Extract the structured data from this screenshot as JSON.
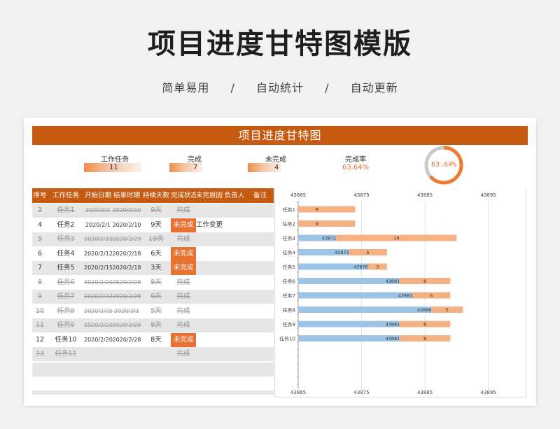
{
  "page": {
    "title": "项目进度甘特图模版",
    "subtitle": [
      "简单易用",
      "/",
      "自动统计",
      "/",
      "自动更新"
    ]
  },
  "sheet": {
    "banner": "项目进度甘特图",
    "stats": {
      "total_label": "工作任务",
      "total_value": "11",
      "done_label": "完成",
      "done_value": "7",
      "undone_label": "未完成",
      "undone_value": "4",
      "rate_label": "完成率",
      "rate_value": "63.64%",
      "donut_text": "63.64%",
      "rate_fraction": 0.6364
    },
    "columns": [
      "序号",
      "工作任务",
      "开始日期",
      "结束时期",
      "持续天数",
      "完成状态",
      "未完原因",
      "负责人",
      "备注"
    ],
    "rows": [
      {
        "id": "3",
        "task": "任务1",
        "start": "2020/2/1",
        "end": "2020/2/10",
        "days": "9天",
        "status": "完成",
        "reason": "",
        "done": true
      },
      {
        "id": "4",
        "task": "任务2",
        "start": "2020/2/1",
        "end": "2020/2/10",
        "days": "9天",
        "status": "未完成",
        "reason": "工作变更",
        "done": false
      },
      {
        "id": "5",
        "task": "任务3",
        "start": "2020/2/10",
        "end": "2020/2/29",
        "days": "19天",
        "status": "完成",
        "reason": "",
        "done": true
      },
      {
        "id": "6",
        "task": "任务4",
        "start": "2020/2/12",
        "end": "2020/2/18",
        "days": "6天",
        "status": "未完成",
        "reason": "",
        "done": false
      },
      {
        "id": "7",
        "task": "任务5",
        "start": "2020/2/15",
        "end": "2020/2/18",
        "days": "3天",
        "status": "未完成",
        "reason": "",
        "done": false
      },
      {
        "id": "8",
        "task": "任务6",
        "start": "2020/2/20",
        "end": "2020/2/28",
        "days": "8天",
        "status": "完成",
        "reason": "",
        "done": true
      },
      {
        "id": "9",
        "task": "任务7",
        "start": "2020/2/22",
        "end": "2020/2/28",
        "days": "6天",
        "status": "完成",
        "reason": "",
        "done": true
      },
      {
        "id": "10",
        "task": "任务8",
        "start": "2020/2/25",
        "end": "2020/3/1",
        "days": "5天",
        "status": "完成",
        "reason": "",
        "done": true
      },
      {
        "id": "11",
        "task": "任务9",
        "start": "2020/2/20",
        "end": "2020/2/28",
        "days": "8天",
        "status": "完成",
        "reason": "",
        "done": true
      },
      {
        "id": "12",
        "task": "任务10",
        "start": "2020/2/20",
        "end": "2020/2/28",
        "days": "8天",
        "status": "未完成",
        "reason": "",
        "done": false
      },
      {
        "id": "13",
        "task": "任务11",
        "start": "",
        "end": "",
        "days": "",
        "status": "完成",
        "reason": "",
        "done": true
      }
    ]
  },
  "chart_data": {
    "type": "bar",
    "orientation": "horizontal-stacked",
    "categories": [
      "任务1",
      "任务2",
      "任务3",
      "任务4",
      "任务5",
      "任务6",
      "任务7",
      "任务8",
      "任务9",
      "任务10"
    ],
    "x_ticks": [
      "43865",
      "43875",
      "43885",
      "43895"
    ],
    "xlim": [
      43865,
      43901
    ],
    "series": [
      {
        "values": [
          null,
          null,
          43871,
          43873,
          43876,
          43881,
          43883,
          43886,
          43881,
          43881
        ],
        "color": "#9dc3e6"
      },
      {
        "values": [
          9,
          9,
          19,
          6,
          3,
          8,
          6,
          5,
          8,
          8
        ],
        "color": "#f4b183"
      }
    ],
    "grid": true,
    "legend": "none"
  }
}
